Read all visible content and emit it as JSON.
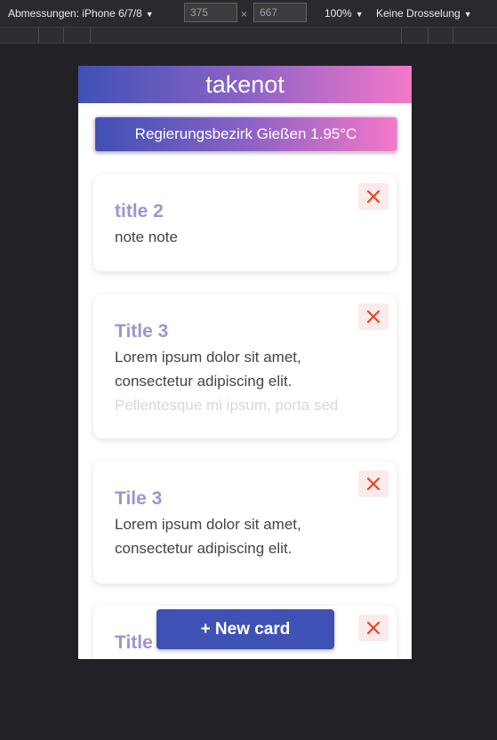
{
  "devtools": {
    "device_label": "Abmessungen: iPhone 6/7/8",
    "width_value": "375",
    "times": "×",
    "height_value": "667",
    "zoom": "100%",
    "throttle": "Keine Drosselung"
  },
  "app": {
    "title": "takenot",
    "weather": "Regierungsbezirk Gießen 1.95°C",
    "cards": [
      {
        "title": "title 2",
        "lines": [
          "note note"
        ],
        "faded": ""
      },
      {
        "title": "Title 3",
        "lines": [
          "Lorem ipsum dolor sit amet,",
          "consectetur adipiscing elit."
        ],
        "faded": "Pellentesque mi ipsum, porta sed"
      },
      {
        "title": "Tile 3",
        "lines": [
          "Lorem ipsum dolor sit amet,",
          "consectetur adipiscing elit."
        ],
        "faded": ""
      },
      {
        "title": "Title",
        "lines": [],
        "faded": ""
      }
    ],
    "new_card_label": "+ New card"
  },
  "colors": {
    "accent": "#3f51b5",
    "gradient_end": "#f478c8",
    "card_title": "#9e93d4",
    "close_icon": "#e2462a"
  },
  "icons": {
    "close": "close-icon",
    "caret": "caret-down-icon"
  }
}
